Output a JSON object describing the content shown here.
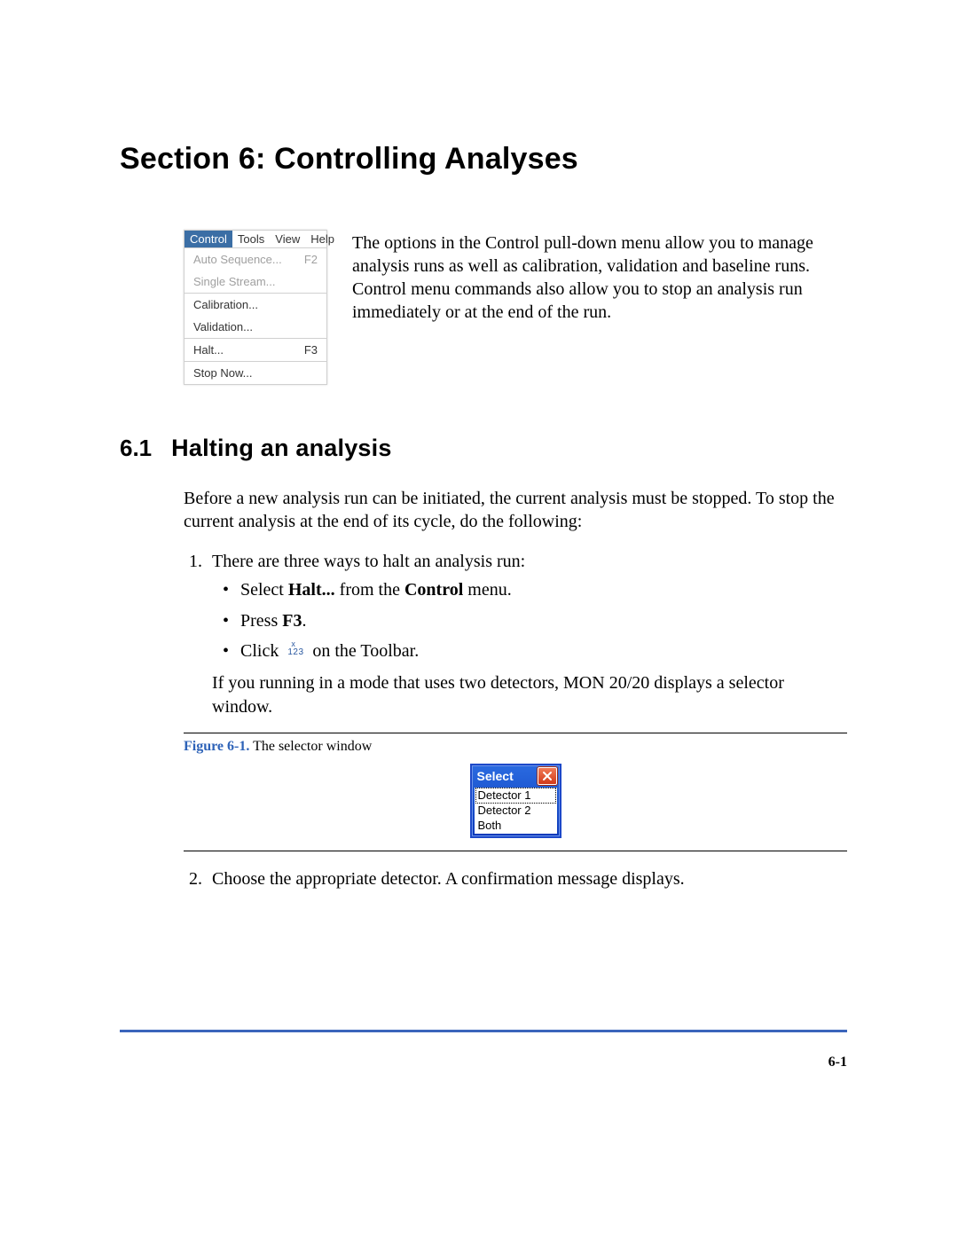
{
  "section": {
    "title": "Section 6: Controlling Analyses",
    "intro": "The options in the Control pull-down menu allow you to manage analysis runs as well as calibration, validation and baseline runs.  Control menu commands also allow you to stop an analysis run immediately or at the end of the run."
  },
  "menu": {
    "bar": [
      "Control",
      "Tools",
      "View",
      "Help"
    ],
    "selected": "Control",
    "groups": [
      [
        {
          "label": "Auto Sequence...",
          "shortcut": "F2",
          "disabled": true
        },
        {
          "label": "Single Stream...",
          "shortcut": "",
          "disabled": true
        }
      ],
      [
        {
          "label": "Calibration...",
          "shortcut": "",
          "disabled": false
        },
        {
          "label": "Validation...",
          "shortcut": "",
          "disabled": false
        }
      ],
      [
        {
          "label": "Halt...",
          "shortcut": "F3",
          "disabled": false
        }
      ],
      [
        {
          "label": "Stop Now...",
          "shortcut": "",
          "disabled": false
        }
      ]
    ]
  },
  "subsection": {
    "number": "6.1",
    "title": "Halting an analysis",
    "intro": "Before a new analysis run can be initiated, the current analysis must be stopped.  To stop the current analysis at the end of its cycle, do the following:",
    "step1_lead": "There are three ways to halt an analysis run:",
    "bullets": {
      "b1_pre": "Select ",
      "b1_bold1": "Halt...",
      "b1_mid": " from the ",
      "b1_bold2": "Control",
      "b1_post": " menu.",
      "b2_pre": "Press ",
      "b2_bold": "F3",
      "b2_post": ".",
      "b3_pre": "Click  ",
      "b3_post": "  on the Toolbar."
    },
    "after_bullets": "If you running in a mode that uses two detectors, MON 20/20 displays a selector window.",
    "step2": "Choose the appropriate detector.  A confirmation message displays."
  },
  "figure": {
    "label": "Figure 6-1.",
    "caption": "  The selector window",
    "window_title": "Select",
    "options": [
      "Detector 1",
      "Detector 2",
      "Both"
    ]
  },
  "toolbar_icon": {
    "top": "x",
    "bottom": "123"
  },
  "footer": {
    "page": "6-1"
  }
}
